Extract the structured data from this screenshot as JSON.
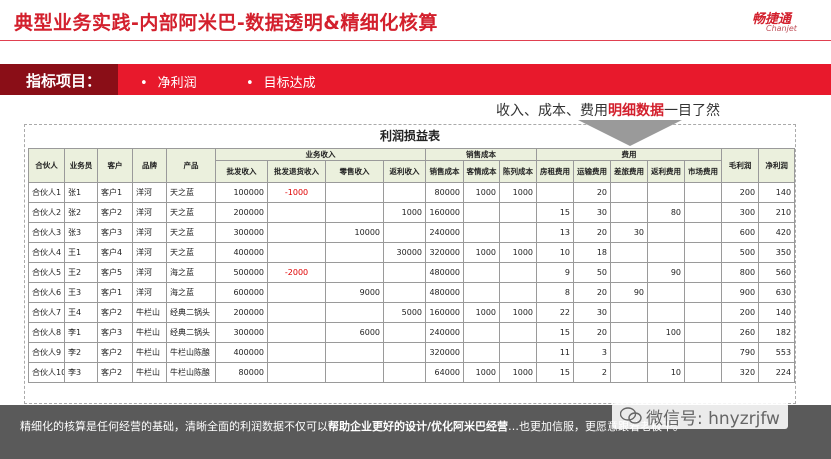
{
  "header": {
    "title": "典型业务实践-内部阿米巴-数据透明&精细化核算",
    "logo_cn": "畅捷通",
    "logo_en": "Chanjet"
  },
  "indicator_bar": {
    "label": "指标项目：",
    "items": [
      "净利润",
      "目标达成"
    ]
  },
  "annotation": {
    "prefix": "收入、成本、费用",
    "highlight": "明细数据",
    "suffix": "一目了然"
  },
  "table": {
    "title": "利润损益表",
    "group_headers": {
      "revenue": "业务收入",
      "cost": "销售成本",
      "expense": "费用"
    },
    "columns": [
      "合伙人",
      "业务员",
      "客户",
      "品牌",
      "产品",
      "批发收入",
      "批发退货收入",
      "零售收入",
      "返利收入",
      "销售成本",
      "客情成本",
      "陈列成本",
      "房租费用",
      "运输费用",
      "差旅费用",
      "返利费用",
      "市场费用",
      "毛利润",
      "净利润"
    ],
    "rows": [
      [
        "合伙人1",
        "张1",
        "客户1",
        "洋河",
        "天之蓝",
        "100000",
        "-1000",
        "",
        "",
        "80000",
        "1000",
        "1000",
        "",
        "20",
        "",
        "",
        "",
        "200",
        "140"
      ],
      [
        "合伙人2",
        "张2",
        "客户2",
        "洋河",
        "天之蓝",
        "200000",
        "",
        "",
        "1000",
        "160000",
        "",
        "",
        "15",
        "30",
        "",
        "80",
        "",
        "300",
        "210"
      ],
      [
        "合伙人3",
        "张3",
        "客户3",
        "洋河",
        "天之蓝",
        "300000",
        "",
        "10000",
        "",
        "240000",
        "",
        "",
        "13",
        "20",
        "30",
        "",
        "",
        "600",
        "420"
      ],
      [
        "合伙人4",
        "王1",
        "客户4",
        "洋河",
        "天之蓝",
        "400000",
        "",
        "",
        "30000",
        "320000",
        "1000",
        "1000",
        "10",
        "18",
        "",
        "",
        "",
        "500",
        "350"
      ],
      [
        "合伙人5",
        "王2",
        "客户5",
        "洋河",
        "海之蓝",
        "500000",
        "-2000",
        "",
        "",
        "480000",
        "",
        "",
        "9",
        "50",
        "",
        "90",
        "",
        "800",
        "560"
      ],
      [
        "合伙人6",
        "王3",
        "客户1",
        "洋河",
        "海之蓝",
        "600000",
        "",
        "9000",
        "",
        "480000",
        "",
        "",
        "8",
        "20",
        "90",
        "",
        "",
        "900",
        "630"
      ],
      [
        "合伙人7",
        "王4",
        "客户2",
        "牛栏山",
        "经典二锅头",
        "200000",
        "",
        "",
        "5000",
        "160000",
        "1000",
        "1000",
        "22",
        "30",
        "",
        "",
        "",
        "200",
        "140"
      ],
      [
        "合伙人8",
        "李1",
        "客户3",
        "牛栏山",
        "经典二锅头",
        "300000",
        "",
        "6000",
        "",
        "240000",
        "",
        "",
        "15",
        "20",
        "",
        "100",
        "",
        "260",
        "182"
      ],
      [
        "合伙人9",
        "李2",
        "客户2",
        "牛栏山",
        "牛栏山陈酿",
        "400000",
        "",
        "",
        "",
        "320000",
        "",
        "",
        "11",
        "3",
        "",
        "",
        "",
        "790",
        "553"
      ],
      [
        "合伙人10",
        "李3",
        "客户2",
        "牛栏山",
        "牛栏山陈酿",
        "80000",
        "",
        "",
        "",
        "64000",
        "1000",
        "1000",
        "15",
        "2",
        "",
        "10",
        "",
        "320",
        "224"
      ]
    ]
  },
  "footer": {
    "text_normal": "精细化的核算是任何经营的基础，清晰全面的利润数据不仅可以",
    "text_bold": "帮助企业更好的设计/优化阿米巴经营",
    "text_partial": "…也更加信服，更愿意跟着老板干。"
  },
  "watermark": {
    "text": "微信号: hnyzrjfw"
  }
}
